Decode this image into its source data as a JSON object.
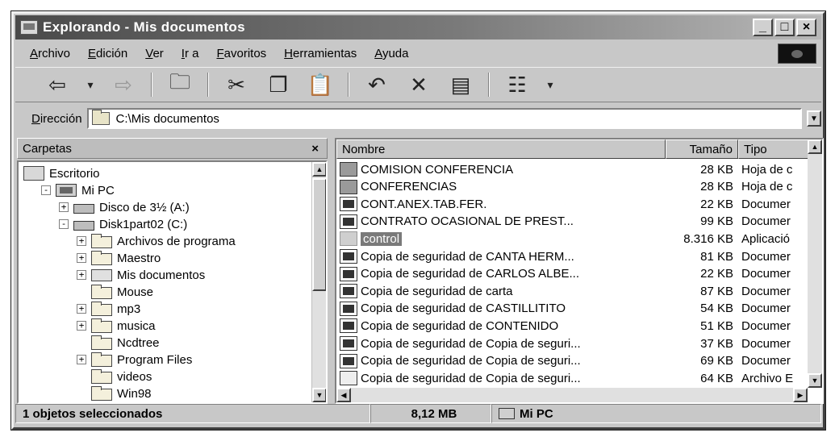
{
  "window": {
    "title": "Explorando - Mis documentos",
    "controls": [
      "_",
      "□",
      "×"
    ]
  },
  "menu": [
    "Archivo",
    "Edición",
    "Ver",
    "Ir a",
    "Favoritos",
    "Herramientas",
    "Ayuda"
  ],
  "toolbar": {
    "icons": [
      "back-icon",
      "dropdown-arrow-icon",
      "forward-icon",
      "up-folder-icon",
      "cut-icon",
      "copy-icon",
      "paste-icon",
      "undo-icon",
      "delete-icon",
      "properties-icon",
      "views-icon",
      "dropdown-arrow-icon"
    ]
  },
  "address": {
    "label": "Dirección",
    "value": "C:\\Mis documentos"
  },
  "folders_pane": {
    "title": "Carpetas",
    "close": "×",
    "tree": [
      {
        "label": "Escritorio",
        "level": 0,
        "expander": "",
        "icon": "desktop"
      },
      {
        "label": "Mi PC",
        "level": 1,
        "expander": "-",
        "icon": "pc"
      },
      {
        "label": "Disco de 3½ (A:)",
        "level": 2,
        "expander": "+",
        "icon": "drive"
      },
      {
        "label": "Disk1part02 (C:)",
        "level": 2,
        "expander": "-",
        "icon": "drive"
      },
      {
        "label": "Archivos de programa",
        "level": 3,
        "expander": "+",
        "icon": "folder"
      },
      {
        "label": "Maestro",
        "level": 3,
        "expander": "+",
        "icon": "folder"
      },
      {
        "label": "Mis documentos",
        "level": 3,
        "expander": "+",
        "icon": "docfolder"
      },
      {
        "label": "Mouse",
        "level": 3,
        "expander": "",
        "icon": "folder"
      },
      {
        "label": "mp3",
        "level": 3,
        "expander": "+",
        "icon": "folder"
      },
      {
        "label": "musica",
        "level": 3,
        "expander": "+",
        "icon": "folder"
      },
      {
        "label": "Ncdtree",
        "level": 3,
        "expander": "",
        "icon": "folder"
      },
      {
        "label": "Program Files",
        "level": 3,
        "expander": "+",
        "icon": "folder"
      },
      {
        "label": "videos",
        "level": 3,
        "expander": "",
        "icon": "folder"
      },
      {
        "label": "Win98",
        "level": 3,
        "expander": "",
        "icon": "folder"
      }
    ]
  },
  "files": {
    "columns": [
      "Nombre",
      "Tamaño",
      "Tipo"
    ],
    "rows": [
      {
        "name": "COMISION CONFERENCIA",
        "size": "28 KB",
        "type": "Hoja de c",
        "icon": "xls"
      },
      {
        "name": "CONFERENCIAS",
        "size": "28 KB",
        "type": "Hoja de c",
        "icon": "xls"
      },
      {
        "name": "CONT.ANEX.TAB.FER.",
        "size": "22 KB",
        "type": "Documer",
        "icon": "doc"
      },
      {
        "name": "CONTRATO OCASIONAL DE PREST...",
        "size": "99 KB",
        "type": "Documer",
        "icon": "doc"
      },
      {
        "name": "control",
        "size": "8.316 KB",
        "type": "Aplicació",
        "icon": "exe",
        "selected": true
      },
      {
        "name": "Copia de seguridad de CANTA HERM...",
        "size": "81 KB",
        "type": "Documer",
        "icon": "doc"
      },
      {
        "name": "Copia de seguridad de CARLOS ALBE...",
        "size": "22 KB",
        "type": "Documer",
        "icon": "doc"
      },
      {
        "name": "Copia de seguridad de carta",
        "size": "87 KB",
        "type": "Documer",
        "icon": "doc"
      },
      {
        "name": "Copia de seguridad de CASTILLITITO",
        "size": "54 KB",
        "type": "Documer",
        "icon": "doc"
      },
      {
        "name": "Copia de seguridad de CONTENIDO",
        "size": "51 KB",
        "type": "Documer",
        "icon": "doc"
      },
      {
        "name": "Copia de seguridad de Copia de seguri...",
        "size": "37 KB",
        "type": "Documer",
        "icon": "doc"
      },
      {
        "name": "Copia de seguridad de Copia de seguri...",
        "size": "69 KB",
        "type": "Documer",
        "icon": "doc"
      },
      {
        "name": "Copia de seguridad de Copia de seguri...",
        "size": "64 KB",
        "type": "Archivo E",
        "icon": "generic"
      }
    ]
  },
  "status": {
    "selection": "1 objetos seleccionados",
    "size": "8,12 MB",
    "location": "Mi PC"
  }
}
